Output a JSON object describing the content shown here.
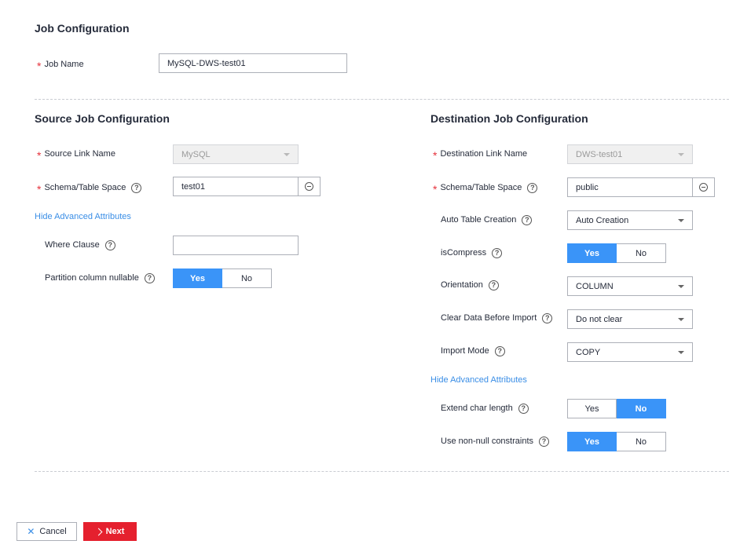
{
  "header": {
    "title": "Job Configuration"
  },
  "job": {
    "label": "Job Name",
    "value": "MySQL-DWS-test01"
  },
  "source": {
    "title": "Source Job Configuration",
    "link_label": "Source Link Name",
    "link_value": "MySQL",
    "schema_label": "Schema/Table Space",
    "schema_value": "test01",
    "advanced_link": "Hide Advanced Attributes",
    "where_label": "Where Clause",
    "where_value": "",
    "partition_label": "Partition column nullable",
    "partition_yes": "Yes",
    "partition_no": "No"
  },
  "dest": {
    "title": "Destination Job Configuration",
    "link_label": "Destination Link Name",
    "link_value": "DWS-test01",
    "schema_label": "Schema/Table Space",
    "schema_value": "public",
    "auto_label": "Auto Table Creation",
    "auto_value": "Auto Creation",
    "compress_label": "isCompress",
    "compress_yes": "Yes",
    "compress_no": "No",
    "orientation_label": "Orientation",
    "orientation_value": "COLUMN",
    "clear_label": "Clear Data Before Import",
    "clear_value": "Do not clear",
    "import_label": "Import Mode",
    "import_value": "COPY",
    "advanced_link": "Hide Advanced Attributes",
    "extend_label": "Extend char length",
    "extend_yes": "Yes",
    "extend_no": "No",
    "nonnull_label": "Use non-null constraints",
    "nonnull_yes": "Yes",
    "nonnull_no": "No"
  },
  "footer": {
    "cancel_label": "Cancel",
    "next_label": "Next"
  },
  "icons": {
    "help": "?",
    "required": "*"
  },
  "colors": {
    "accent": "#3a94f8",
    "danger": "#e5202e",
    "link": "#3a8ee6"
  }
}
